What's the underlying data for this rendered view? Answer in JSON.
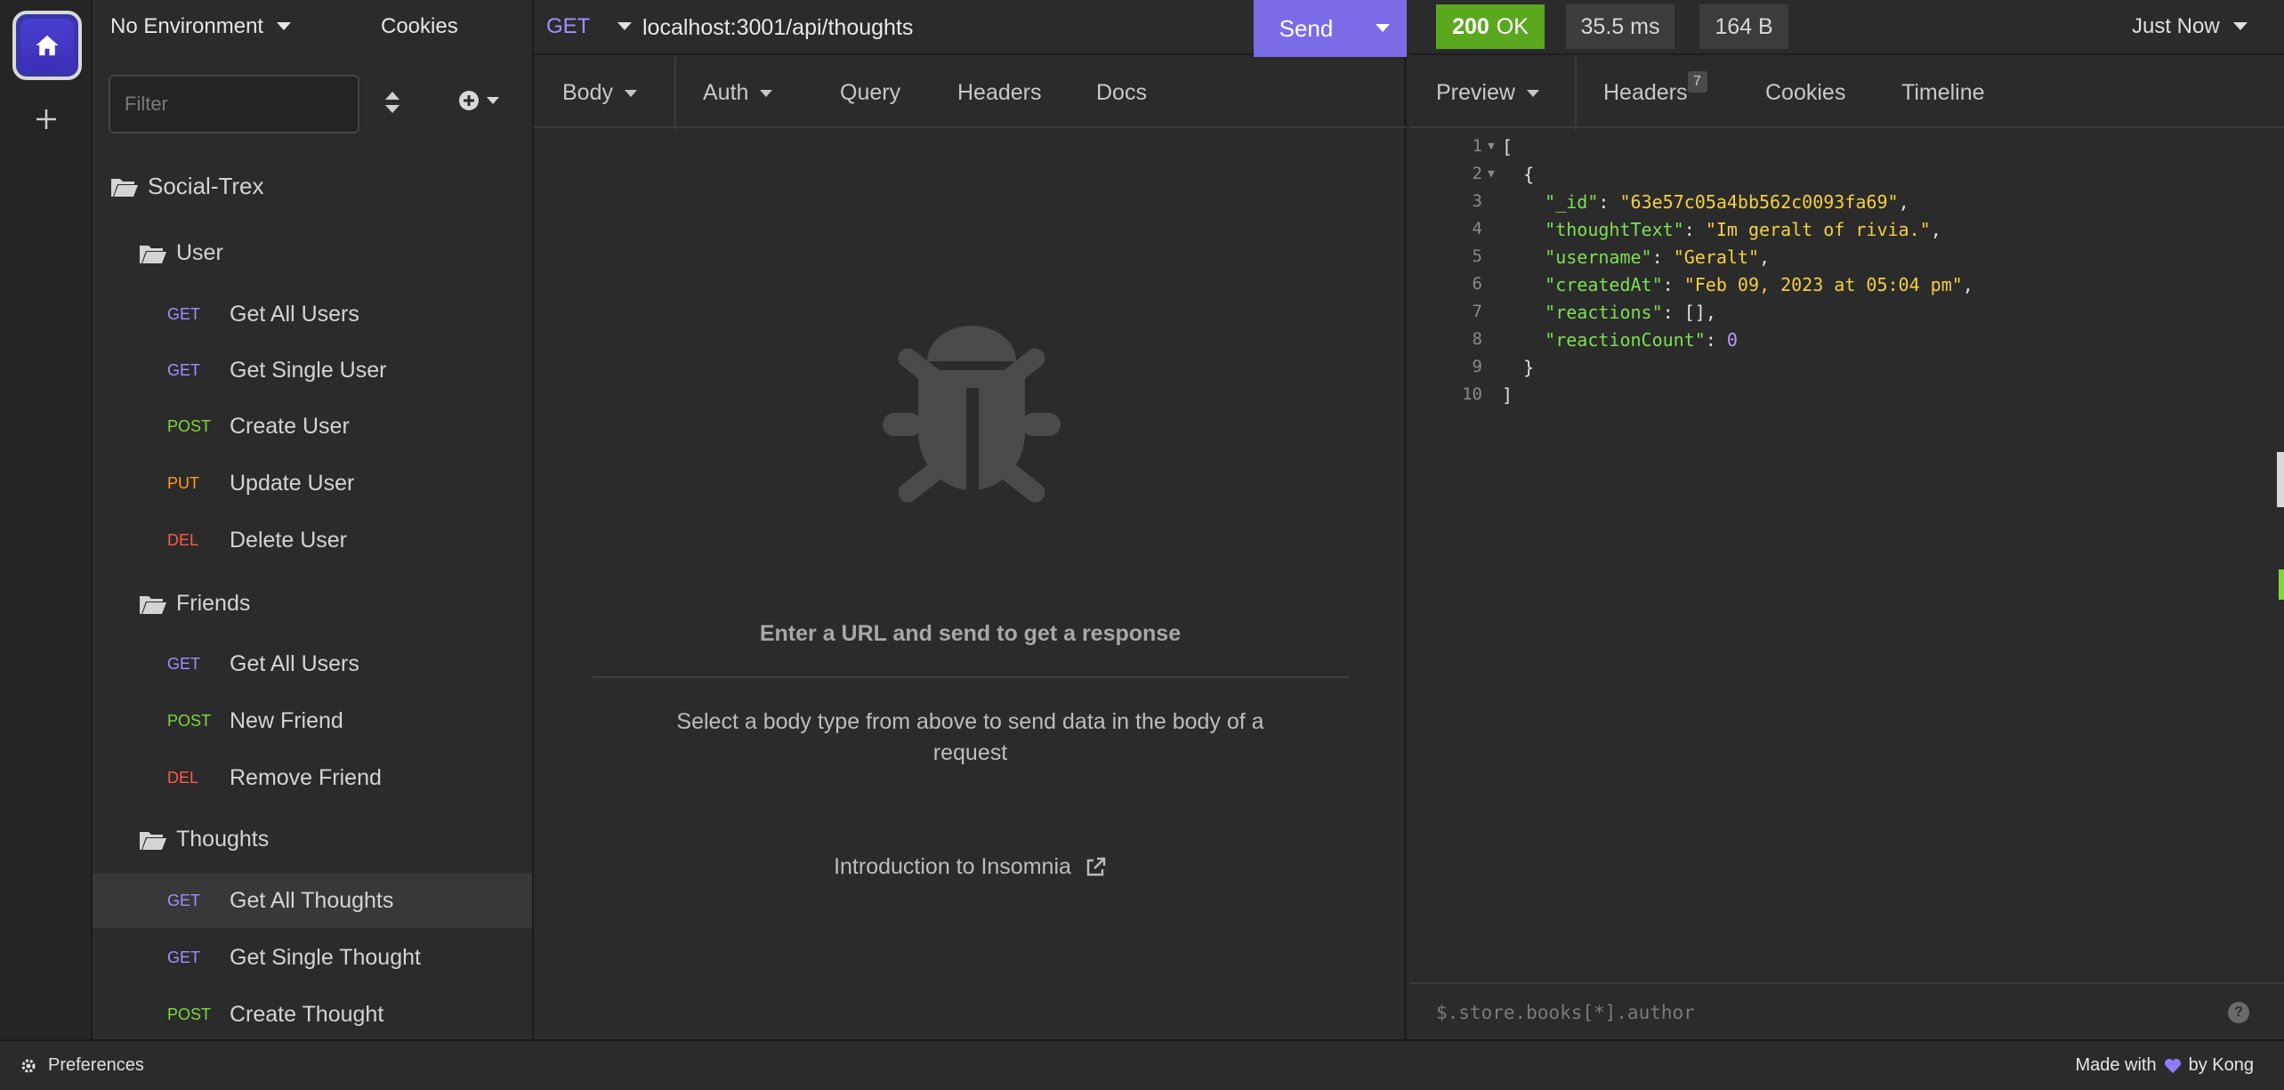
{
  "sidebar": {
    "environment": "No Environment",
    "cookies": "Cookies",
    "filter_placeholder": "Filter",
    "tree": [
      {
        "kind": "folder",
        "label": "Social-Trex"
      },
      {
        "kind": "folder",
        "label": "User"
      },
      {
        "kind": "request",
        "method": "GET",
        "label": "Get All Users"
      },
      {
        "kind": "request",
        "method": "GET",
        "label": "Get Single User"
      },
      {
        "kind": "request",
        "method": "POST",
        "label": "Create User"
      },
      {
        "kind": "request",
        "method": "PUT",
        "label": "Update User"
      },
      {
        "kind": "request",
        "method": "DEL",
        "label": "Delete User"
      },
      {
        "kind": "folder",
        "label": "Friends"
      },
      {
        "kind": "request",
        "method": "GET",
        "label": "Get All Users"
      },
      {
        "kind": "request",
        "method": "POST",
        "label": "New Friend"
      },
      {
        "kind": "request",
        "method": "DEL",
        "label": "Remove Friend"
      },
      {
        "kind": "folder",
        "label": "Thoughts"
      },
      {
        "kind": "request",
        "method": "GET",
        "label": "Get All Thoughts",
        "selected": true
      },
      {
        "kind": "request",
        "method": "GET",
        "label": "Get Single Thought"
      },
      {
        "kind": "request",
        "method": "POST",
        "label": "Create Thought"
      }
    ]
  },
  "request": {
    "method": "GET",
    "url": "localhost:3001/api/thoughts",
    "send_label": "Send",
    "tabs": [
      "Body",
      "Auth",
      "Query",
      "Headers",
      "Docs"
    ],
    "empty_title": "Enter a URL and send to get a response",
    "empty_desc": "Select a body type from above to send data in the body of a request",
    "intro_link": "Introduction to Insomnia"
  },
  "response": {
    "status_code": "200",
    "status_text": "OK",
    "time": "35.5 ms",
    "size": "164 B",
    "when": "Just Now",
    "tabs": [
      "Preview",
      "Headers",
      "Cookies",
      "Timeline"
    ],
    "headers_count": "7",
    "lines": [
      "1",
      "2",
      "3",
      "4",
      "5",
      "6",
      "7",
      "8",
      "9",
      "10"
    ],
    "json": {
      "id_key": "\"_id\"",
      "id_val": "\"63e57c05a4bb562c0093fa69\"",
      "thought_key": "\"thoughtText\"",
      "thought_val": "\"Im geralt of rivia.\"",
      "username_key": "\"username\"",
      "username_val": "\"Geralt\"",
      "created_key": "\"createdAt\"",
      "created_val": "\"Feb 09, 2023 at 05:04 pm\"",
      "reactions_key": "\"reactions\"",
      "reactions_val": "[]",
      "count_key": "\"reactionCount\"",
      "count_val": "0"
    },
    "jsonpath_placeholder": "$.store.books[*].author",
    "help": "?"
  },
  "statusbar": {
    "preferences": "Preferences",
    "made_with_prefix": "Made with",
    "made_with_suffix": "by Kong"
  },
  "colors": {
    "get": "#a090ff",
    "post": "#7cd93a",
    "put": "#ff9a1f",
    "del": "#ff5a4a",
    "accent": "#7a6ce6",
    "ok": "#5ba81f"
  }
}
